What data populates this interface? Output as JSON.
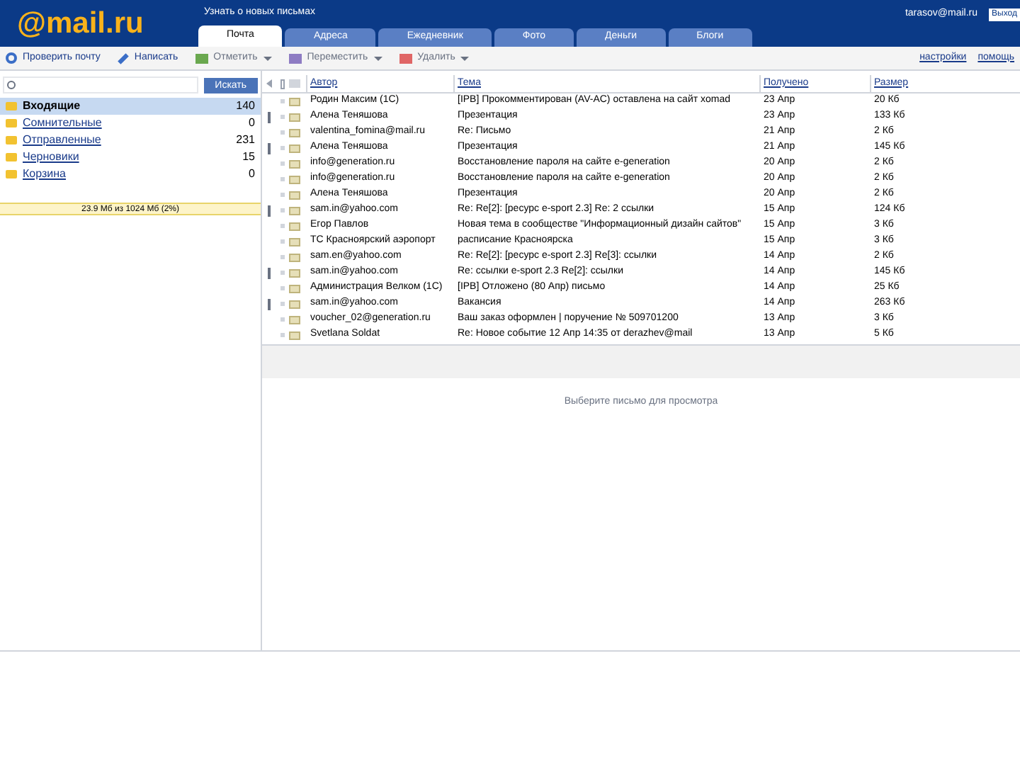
{
  "header": {
    "logo": "@mail.ru",
    "notice": "Узнать о новых письмах",
    "account": "tarasov@mail.ru",
    "exit": "Выход"
  },
  "tabs": [
    {
      "label": "Почта",
      "selected": true
    },
    {
      "label": "Адреса",
      "selected": false
    },
    {
      "label": "Ежедневник",
      "selected": false
    },
    {
      "label": "Фото",
      "selected": false
    },
    {
      "label": "Деньги",
      "selected": false
    },
    {
      "label": "Блоги",
      "selected": false
    }
  ],
  "toolbar": {
    "check": "Проверить почту",
    "compose": "Написать",
    "actions": [
      "Отметить",
      "Переместить",
      "Удалить"
    ],
    "links": [
      "настройки",
      "помощь"
    ]
  },
  "search": {
    "button": "Искать"
  },
  "folders": [
    {
      "name": "Входящие",
      "count": "140",
      "selected": true
    },
    {
      "name": "Сомнительные",
      "count": "0",
      "selected": false
    },
    {
      "name": "Отправленные",
      "count": "231",
      "selected": false
    },
    {
      "name": "Черновики",
      "count": "15",
      "selected": false
    },
    {
      "name": "Корзина",
      "count": "0",
      "selected": false
    }
  ],
  "quota": "23.9 Мб из 1024 Мб (2%)",
  "columns": [
    "Автор",
    "Тема",
    "Получено",
    "Размер"
  ],
  "messages": [
    {
      "flagged": false,
      "from": "Родин Максим (1С)",
      "subject": "[IPB] Прокомментирован (AV-AC) оставлена на сайт xomad",
      "date": "23 Апр",
      "size": "20 Кб"
    },
    {
      "flagged": true,
      "from": "Алена Теняшова",
      "subject": "Презентация",
      "date": "23 Апр",
      "size": "133 Кб"
    },
    {
      "flagged": false,
      "from": "valentina_fomina@mail.ru",
      "subject": "Re: Письмо",
      "date": "21 Апр",
      "size": "2 Кб"
    },
    {
      "flagged": true,
      "from": "Алена Теняшова",
      "subject": "Презентация",
      "date": "21 Апр",
      "size": "145 Кб"
    },
    {
      "flagged": false,
      "from": "info@generation.ru",
      "subject": "Восстановление пароля на сайте e-generation",
      "date": "20 Апр",
      "size": "2 Кб"
    },
    {
      "flagged": false,
      "from": "info@generation.ru",
      "subject": "Восстановление пароля на сайте e-generation",
      "date": "20 Апр",
      "size": "2 Кб"
    },
    {
      "flagged": false,
      "from": "Алена Теняшова",
      "subject": "Презентация",
      "date": "20 Апр",
      "size": "2 Кб"
    },
    {
      "flagged": true,
      "from": "sam.in@yahoo.com",
      "subject": "Re: Re[2]: [ресурс e-sport 2.3] Re: 2 ссылки",
      "date": "15 Апр",
      "size": "124 Кб"
    },
    {
      "flagged": false,
      "from": "Егор Павлов",
      "subject": "Новая тема в сообществе \"Информационный дизайн сайтов\"",
      "date": "15 Апр",
      "size": "3 Кб"
    },
    {
      "flagged": false,
      "from": "ТС Красноярский аэропорт",
      "subject": "расписание Красноярска",
      "date": "15 Апр",
      "size": "3 Кб"
    },
    {
      "flagged": false,
      "from": "sam.en@yahoo.com",
      "subject": "Re: Re[2]: [ресурс e-sport 2.3] Re[3]: ссылки",
      "date": "14 Апр",
      "size": "2 Кб"
    },
    {
      "flagged": true,
      "from": "sam.in@yahoo.com",
      "subject": "Re: ссылки e-sport 2.3 Re[2]: ссылки",
      "date": "14 Апр",
      "size": "145 Кб"
    },
    {
      "flagged": false,
      "from": "Администрация Велком (1С)",
      "subject": "[IPB] Отложено (80 Апр) письмо",
      "date": "14 Апр",
      "size": "25 Кб"
    },
    {
      "flagged": true,
      "from": "sam.in@yahoo.com",
      "subject": "Вакансия",
      "date": "14 Апр",
      "size": "263 Кб"
    },
    {
      "flagged": false,
      "from": "voucher_02@generation.ru",
      "subject": "Ваш заказ оформлен | поручение № 509701200",
      "date": "13 Апр",
      "size": "3 Кб"
    },
    {
      "flagged": false,
      "from": "Svetlana Soldat",
      "subject": "Re: Новое событие 12 Апр 14:35 от derazhev@mail",
      "date": "13 Апр",
      "size": "5 Кб"
    }
  ],
  "preview_message": "Выберите письмо для просмотра"
}
